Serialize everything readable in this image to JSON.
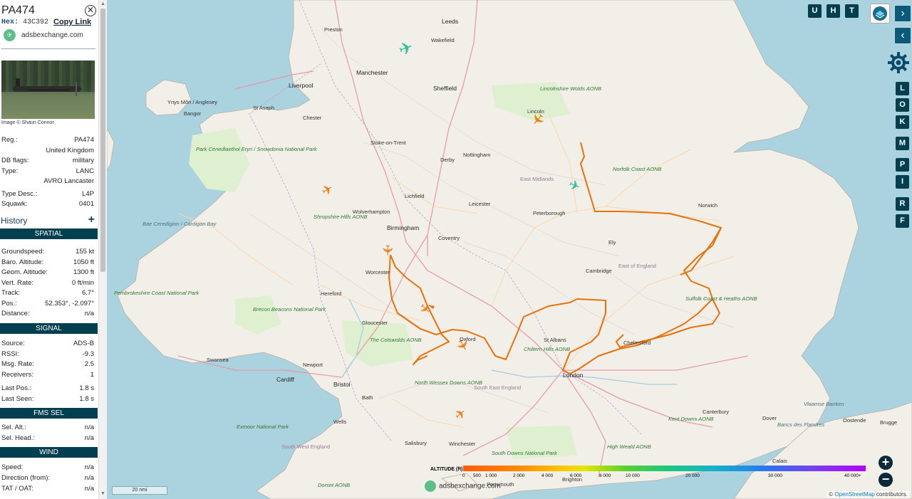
{
  "aircraft": {
    "callsign": "PA474",
    "hex_label": "Hex:",
    "hex": "43C392",
    "copy_link": "Copy Link",
    "site": "adsbexchange.com",
    "image_credit": "Image © Shaun Connor"
  },
  "info_rows": [
    {
      "k": "Reg.:",
      "v": "PA474"
    },
    {
      "k": "",
      "v": "United Kingdom"
    },
    {
      "k": "DB flags:",
      "v": "military"
    },
    {
      "k": "Type:",
      "v": "LANC"
    },
    {
      "k": "",
      "v": "AVRO Lancaster"
    },
    {
      "k": "Type Desc.:",
      "v": "L4P"
    },
    {
      "k": "Squawk:",
      "v": "0401"
    }
  ],
  "history_label": "History",
  "sections": {
    "spatial": "SPATIAL",
    "signal": "SIGNAL",
    "fms": "FMS SEL",
    "wind": "WIND"
  },
  "spatial_rows": [
    {
      "k": "Groundspeed:",
      "v": "155 kt"
    },
    {
      "k": "Baro. Altitude:",
      "v": "1050 ft"
    },
    {
      "k": "Geom. Altitude:",
      "v": "1300 ft"
    },
    {
      "k": "Vert. Rate:",
      "v": "0 ft/min"
    },
    {
      "k": "Track:",
      "v": "6.7°"
    },
    {
      "k": "Pos.:",
      "v": "52.353°, -2.097°"
    },
    {
      "k": "Distance:",
      "v": "n/a"
    }
  ],
  "signal_rows": [
    {
      "k": "Source:",
      "v": "ADS-B"
    },
    {
      "k": "RSSI:",
      "v": "-9.3"
    },
    {
      "k": "Msg. Rate:",
      "v": "2.5"
    },
    {
      "k": "Receivers:",
      "v": "1"
    },
    {
      "k": "Last Pos.:",
      "v": "1.8 s"
    },
    {
      "k": "Last Seen:",
      "v": "1.8 s"
    }
  ],
  "fms_rows": [
    {
      "k": "Sel. Alt.:",
      "v": "n/a"
    },
    {
      "k": "Sel. Head.:",
      "v": "n/a"
    }
  ],
  "wind_rows": [
    {
      "k": "Speed:",
      "v": "n/a"
    },
    {
      "k": "Direction (from):",
      "v": "n/a"
    },
    {
      "k": "TAT / OAT:",
      "v": "n/a"
    }
  ],
  "map_buttons": {
    "top": [
      "U",
      "H",
      "T"
    ],
    "side": [
      "L",
      "O",
      "K",
      "M",
      "P",
      "I",
      "R",
      "F"
    ]
  },
  "map_labels": {
    "cities": [
      "Leeds",
      "Preston",
      "Wakefield",
      "Manchester",
      "Liverpool",
      "Sheffield",
      "Lincoln",
      "Chester",
      "Stoke-on-Trent",
      "Nottingham",
      "Derby",
      "Lichfield",
      "Leicester",
      "Peterborough",
      "Norwich",
      "Wolverhampton",
      "Birmingham",
      "Coventry",
      "Worcester",
      "Hereford",
      "Ely",
      "Cambridge",
      "Gloucester",
      "Oxford",
      "St Albans",
      "London",
      "Bristol",
      "Cardiff",
      "Newport",
      "Swansea",
      "Bath",
      "Wells",
      "Salisbury",
      "Winchester",
      "Canterbury",
      "Brighton",
      "Portsmouth",
      "Chelmsford",
      "Dover",
      "Calais",
      "Oostende",
      "Brugge",
      "St Asaph",
      "Bangor",
      "Ynys Môn / Anglesey",
      "Lincolnshire Wolds AONB",
      "Norfolk Coast AONB",
      "East Midlands",
      "East of England",
      "South East England",
      "Park Cenedlaethol Eryri / Snowdonia National Park",
      "Shropshire Hills AONB",
      "Bae Ceredigion / Cardigan Bay",
      "Pembrokeshire Coast National Park",
      "Brecon Beacons National Park",
      "The Cotswolds AONB",
      "Chiltern Hills AONB",
      "North Wessex Downs AONB",
      "Exmoor National Park",
      "South West England",
      "South Downs National Park",
      "High Weald AONB",
      "Kent Downs AONB",
      "Suffolk Coast & Heaths AONB",
      "Dorset AONB",
      "Vlaamse Banken",
      "Bancs des Flandres"
    ]
  },
  "altitude_legend": {
    "label": "ALTITUDE (ft)",
    "ticks": [
      "0",
      "500",
      "1 000",
      "2 000",
      "4 000",
      "6 000",
      "8 000",
      "10 000",
      "20 000",
      "30 000",
      "40 000+"
    ]
  },
  "scale_label": "20 nmi",
  "attribution": {
    "prefix": "© ",
    "link": "OpenStreetMap",
    "suffix": " contributors."
  },
  "watermark": "adsbexchange.com",
  "colors": {
    "track": "#e8710a",
    "panel": "#003f4f",
    "selected_aircraft": "#f0801a",
    "other_aircraft": "#2fbfa0"
  }
}
